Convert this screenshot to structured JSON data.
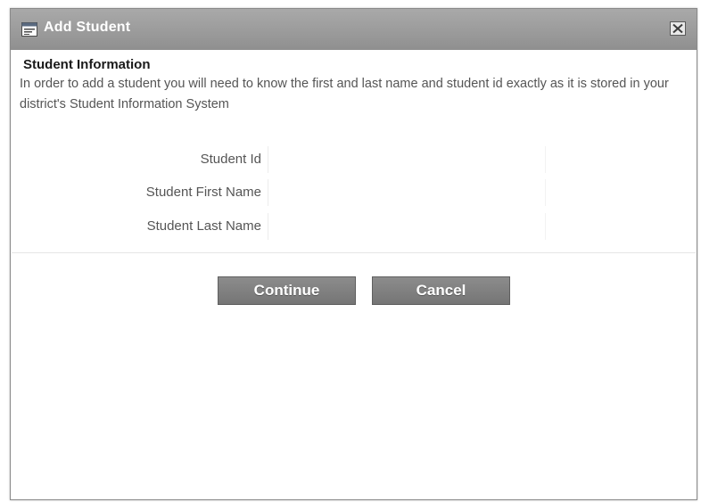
{
  "dialog": {
    "title": "Add Student",
    "title_icon": "form-icon",
    "close_icon": "close-x-icon"
  },
  "section": {
    "title": "Student Information",
    "instructions": "In order to add a student you will need to know the first and last name and student id exactly as it is stored in your district's Student Information System"
  },
  "form": {
    "fields": [
      {
        "label": "Student Id",
        "value": "",
        "placeholder": ""
      },
      {
        "label": "Student First Name",
        "value": "",
        "placeholder": ""
      },
      {
        "label": "Student Last Name",
        "value": "",
        "placeholder": ""
      }
    ]
  },
  "buttons": {
    "continue_label": "Continue",
    "cancel_label": "Cancel"
  },
  "colors": {
    "titlebar": "#9a9a9a",
    "button": "#7f7f7f",
    "text": "#555555"
  }
}
